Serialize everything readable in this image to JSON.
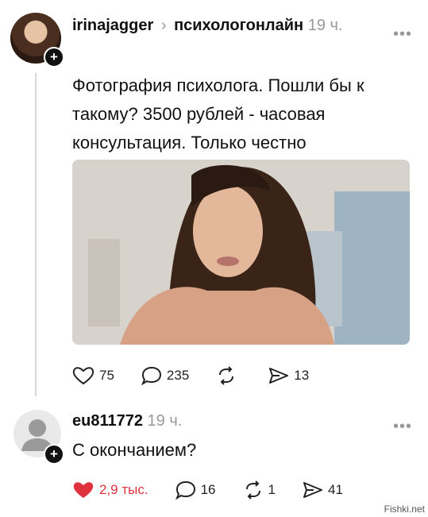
{
  "post": {
    "author": "irinajagger",
    "separator": "›",
    "community": "психологонлайн",
    "time": "19 ч.",
    "more_icon": "more-dots-icon",
    "text": "Фотография психолога. Пошли бы к такому? 3500 рублей - часовая консультация. Только честно",
    "actions": {
      "likes": "75",
      "comments": "235",
      "reposts": "",
      "shares": "13"
    }
  },
  "reply": {
    "author": "eu811772",
    "time": "19 ч.",
    "text": "С окончанием?",
    "actions": {
      "likes": "2,9 тыс.",
      "comments": "16",
      "reposts": "1",
      "shares": "41"
    },
    "liked_color": "#e0323e"
  },
  "watermark": "Fishki.net"
}
